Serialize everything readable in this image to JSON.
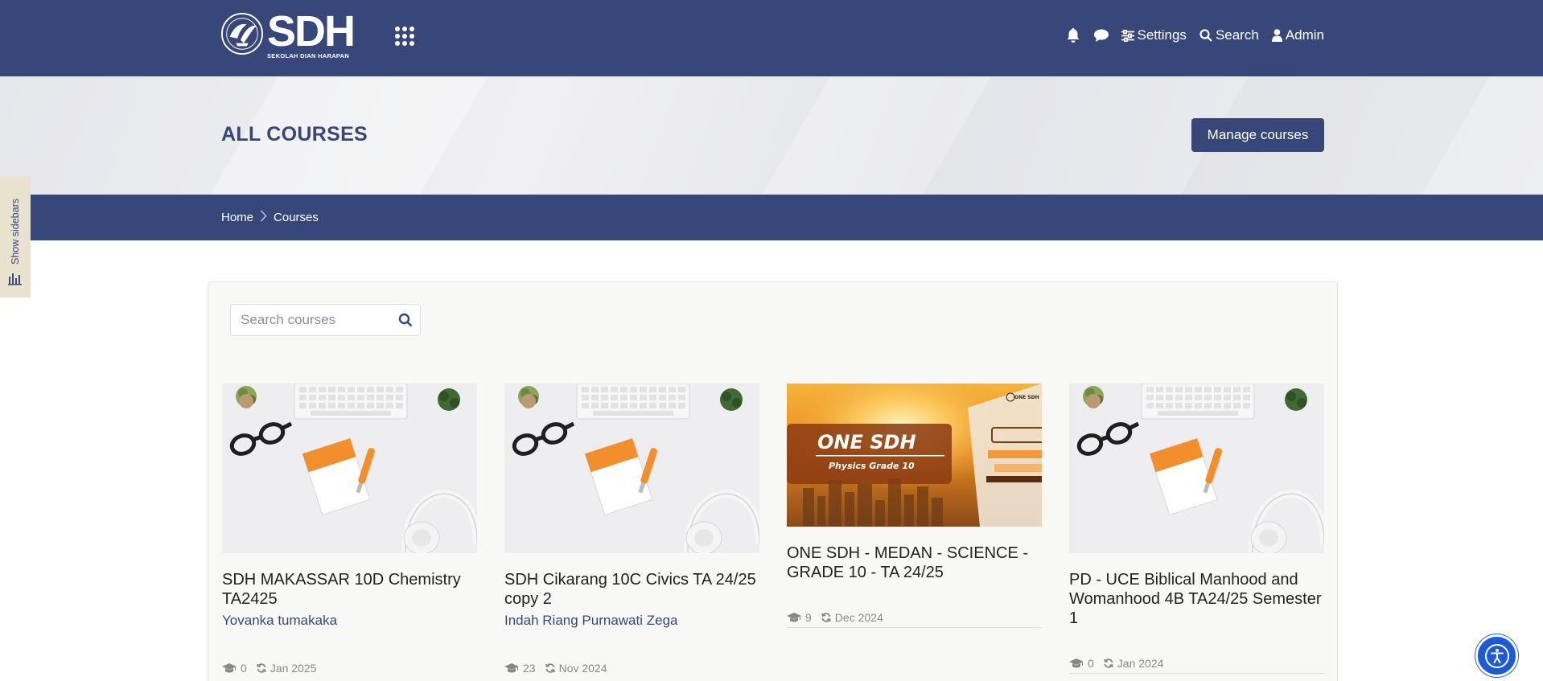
{
  "brand": {
    "logo_text": "SDH",
    "logo_subtext": "SEKOLAH DIAN HARAPAN",
    "emblem_lettering": "SEKOLAH DIAN HARAPAN"
  },
  "colors": {
    "primary": "#37477a",
    "accent_button": "#1d5bd6",
    "sidebar_tab": "#e8e2cf",
    "muted_text": "#888888"
  },
  "navbar": {
    "apps_icon": "apps-grid-icon",
    "notifications_icon": "bell-icon",
    "messages_icon": "chat-bubble-icon",
    "settings_label": "Settings",
    "search_label": "Search",
    "user_label": "Admin"
  },
  "page": {
    "title": "ALL COURSES",
    "manage_button": "Manage courses"
  },
  "breadcrumb": [
    "Home",
    "Courses"
  ],
  "sidebar_toggle": {
    "label": "Show sidebars"
  },
  "search": {
    "placeholder": "Search courses",
    "value": ""
  },
  "courses": [
    {
      "title": "SDH MAKASSAR 10D Chemistry TA2425",
      "teacher": "Yovanka tumakaka",
      "students": "0",
      "updated": "Jan 2025",
      "image": "desk-flatlay"
    },
    {
      "title": "SDH Cikarang 10C Civics TA 24/25 copy 2",
      "teacher": "Indah Riang Purnawati Zega",
      "students": "23",
      "updated": "Nov 2024",
      "image": "desk-flatlay"
    },
    {
      "title": "ONE SDH - MEDAN - SCIENCE - GRADE 10 - TA 24/25",
      "teacher": "",
      "students": "9",
      "updated": "Dec 2024",
      "image": "one-sdh-physics",
      "image_title": "ONE SDH",
      "image_subtitle": "Physics Grade 10",
      "image_badge": "ONE SDH"
    },
    {
      "title": "PD - UCE Biblical Manhood and Womanhood 4B TA24/25 Semester 1",
      "teacher": "",
      "students": "0",
      "updated": "Jan 2024",
      "image": "desk-flatlay"
    }
  ],
  "accessibility": {
    "icon": "accessibility-icon"
  }
}
